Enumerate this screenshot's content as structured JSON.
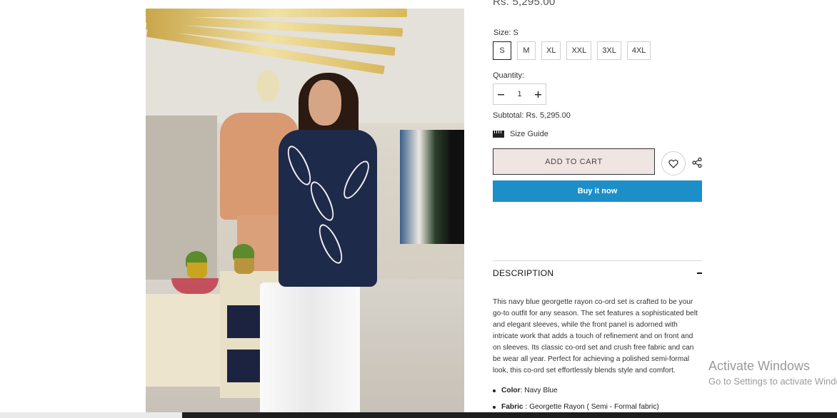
{
  "product": {
    "price": "Rs. 5,295.00",
    "size_label": "Size:",
    "size_value": "S",
    "sizes": [
      "S",
      "M",
      "XL",
      "XXL",
      "3XL",
      "4XL"
    ],
    "selected_size": "S",
    "quantity_label": "Quantity:",
    "quantity_value": "1",
    "subtotal": "Subtotal: Rs. 5,295.00",
    "size_guide": "Size Guide",
    "add_to_cart": "ADD TO CART",
    "buy_now": "Buy it now"
  },
  "description": {
    "title": "DESCRIPTION",
    "lines": [
      "This navy blue georgette rayon co-ord set is crafted to be your",
      "go-to outfit for any season. The set features a sophisticated belt",
      "and elegant sleeves, while the front panel is adorned with",
      "intricate work that adds a touch of refinement and on front and",
      "on sleeves. Its classic co-ord set and crush free fabric and can",
      "be wear all year. Perfect for achieving a polished semi-formal",
      "look, this co-ord set effortlessly blends style and comfort."
    ],
    "attributes": [
      {
        "label": "Color",
        "sep": ": ",
        "value": "Navy Blue"
      },
      {
        "label": "Fabric",
        "sep": " : ",
        "value": "Georgette Rayon ( Semi - Formal fabric)"
      }
    ]
  },
  "watermark": {
    "line1": "Activate Windows",
    "line2": "Go to Settings to activate Windows."
  },
  "icons": {
    "ruler": "ruler-icon",
    "heart": "heart-icon",
    "share": "share-icon",
    "minus": "minus-icon",
    "plus": "plus-icon"
  },
  "colors": {
    "buy_now_bg": "#1c8fc9",
    "add_to_cart_bg": "#efe5e3"
  }
}
